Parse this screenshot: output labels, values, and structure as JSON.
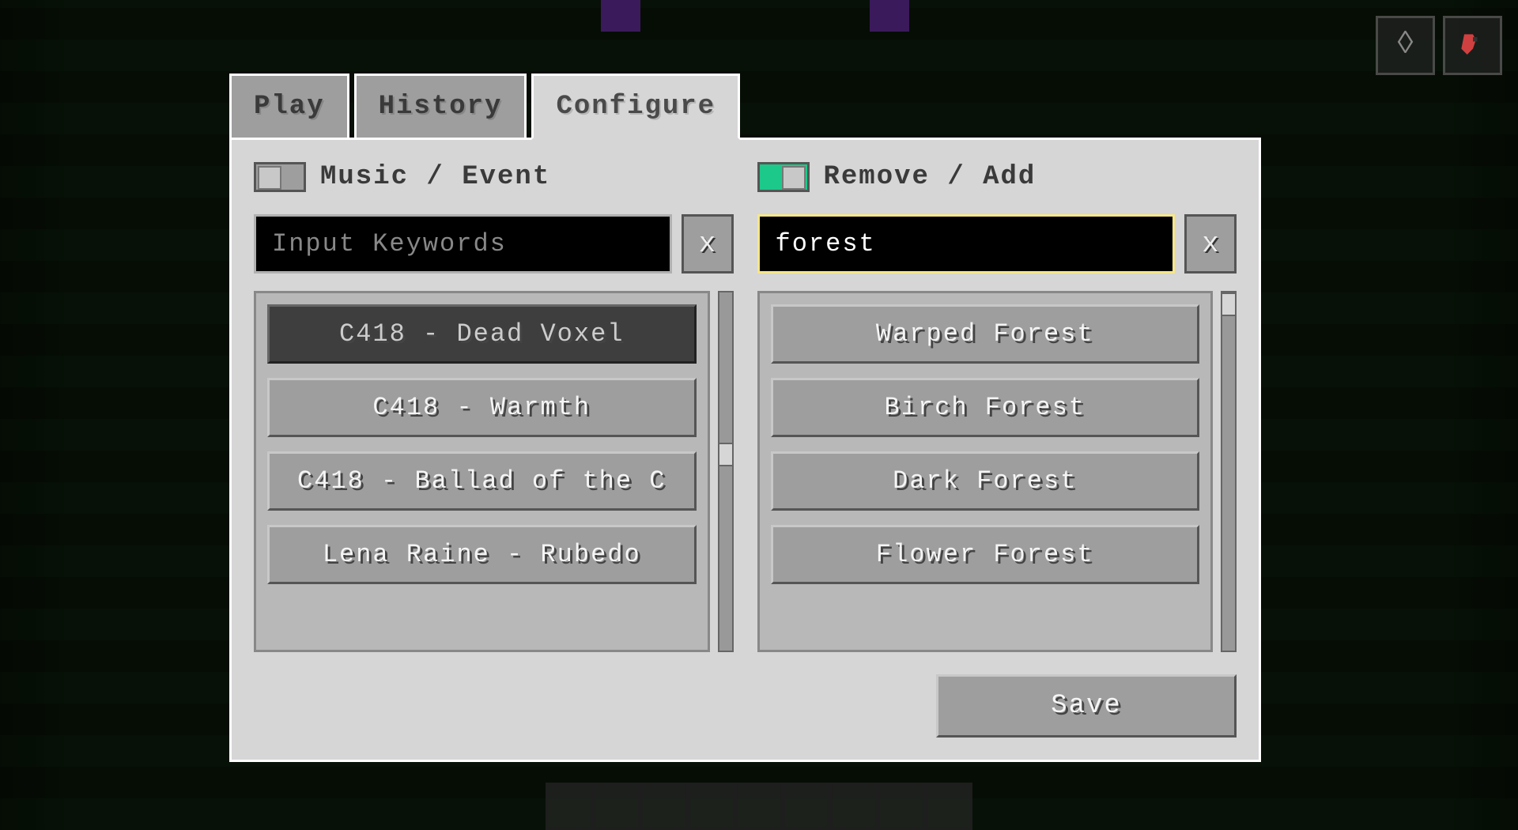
{
  "tabs": {
    "play": "Play",
    "history": "History",
    "configure": "Configure",
    "active": "Configure"
  },
  "left": {
    "toggle_label": "Music / Event",
    "toggle_on": false,
    "search_placeholder": "Input Keywords",
    "search_value": "",
    "clear_label": "x",
    "items": [
      "C418 - Dead Voxel",
      "C418 - Warmth",
      "C418 - Ballad of the C",
      "Lena Raine - Rubedo"
    ],
    "selected_index": 0
  },
  "right": {
    "toggle_label": "Remove / Add",
    "toggle_on": true,
    "search_placeholder": "",
    "search_value": "forest",
    "clear_label": "x",
    "items": [
      "Warped Forest",
      "Birch Forest",
      "Dark Forest",
      "Flower Forest"
    ]
  },
  "footer": {
    "save_label": "Save"
  },
  "hud": {
    "icon1": "shield-icon",
    "icon2": "parrot-icon"
  }
}
